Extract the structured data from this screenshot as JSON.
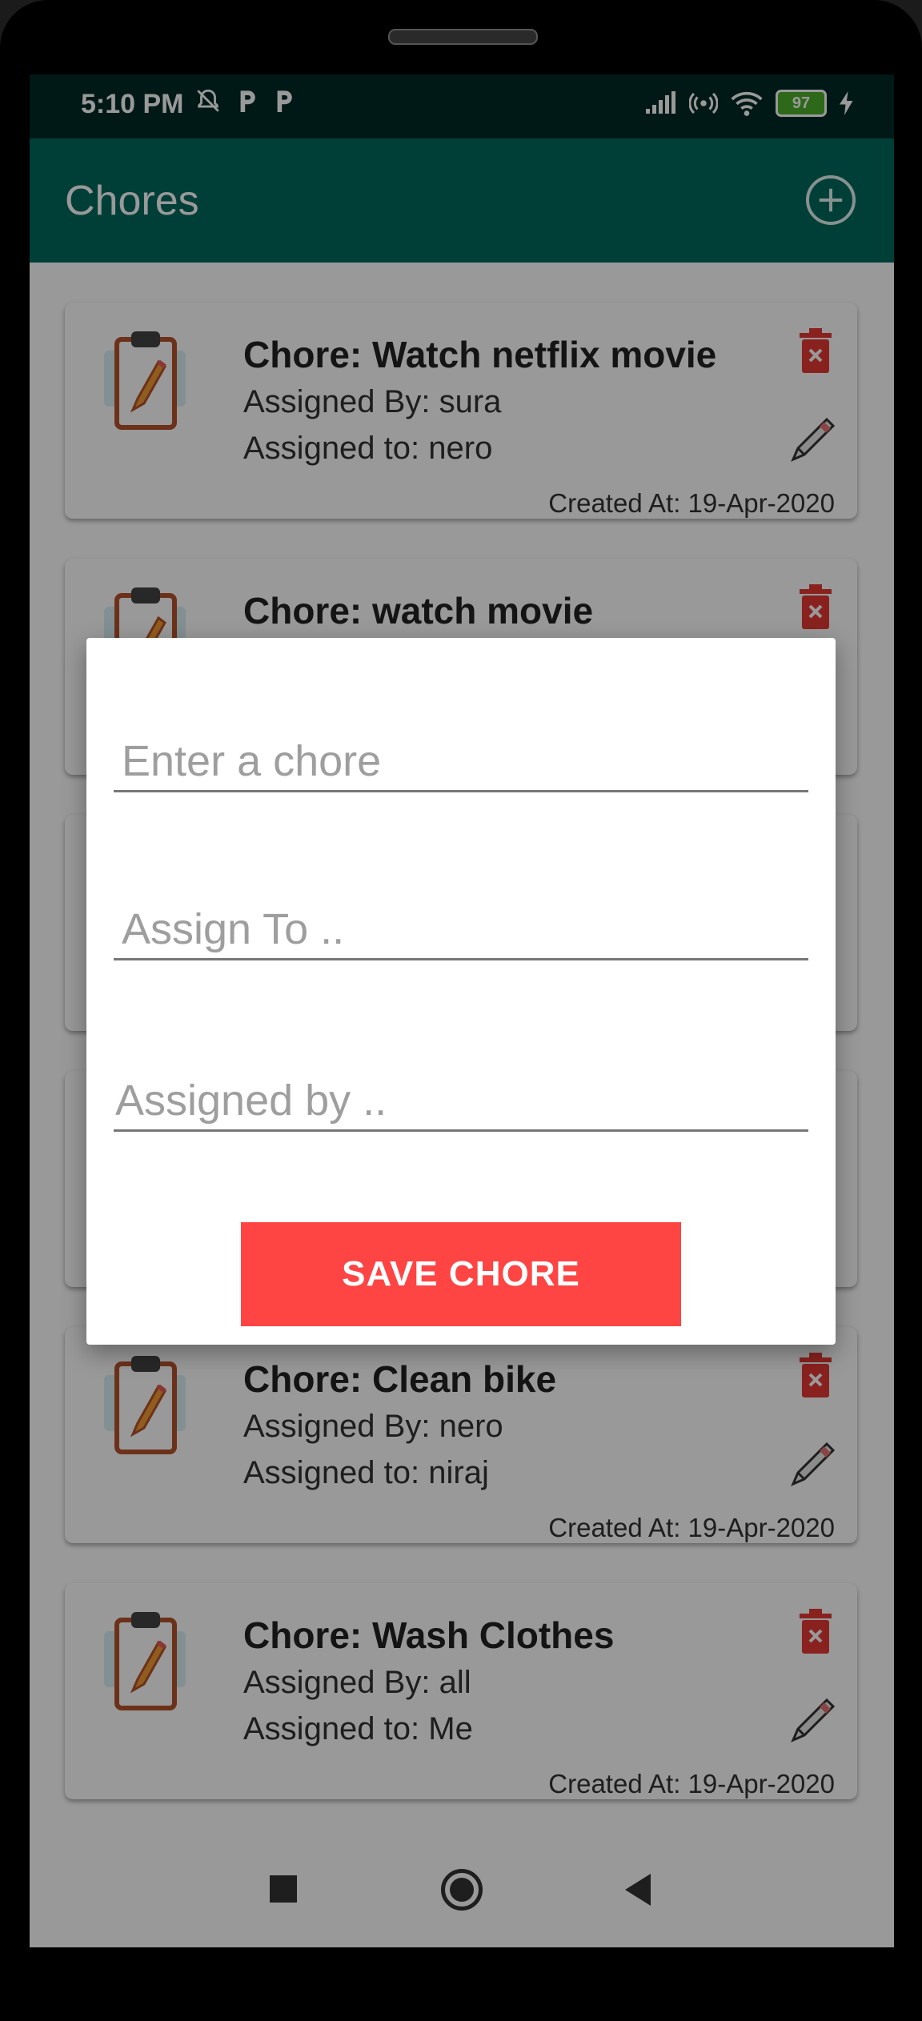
{
  "status_bar": {
    "time": "5:10 PM",
    "battery": "97",
    "icons_left": [
      "notifications-off-icon",
      "parking-icon",
      "parking-icon"
    ],
    "icons_right": [
      "signal-icon",
      "hotspot-icon",
      "wifi-icon",
      "battery-icon",
      "charging-icon"
    ]
  },
  "app_bar": {
    "title": "Chores",
    "add_icon": "add-circle-icon"
  },
  "chores": [
    {
      "title": "Chore: Watch netflix movie",
      "assigned_by": "Assigned By: sura",
      "assigned_to": "Assigned to: nero",
      "created": "Created At: 19-Apr-2020"
    },
    {
      "title": "Chore: watch movie",
      "assigned_by": "",
      "assigned_to": "",
      "created": ""
    },
    {
      "title": "",
      "assigned_by": "",
      "assigned_to": "",
      "created": ""
    },
    {
      "title": "",
      "assigned_by": "",
      "assigned_to": "",
      "created": ""
    },
    {
      "title": "Chore: Clean bike",
      "assigned_by": "Assigned By: nero",
      "assigned_to": "Assigned to: niraj",
      "created": "Created At: 19-Apr-2020"
    },
    {
      "title": "Chore: Wash Clothes",
      "assigned_by": "Assigned By: all",
      "assigned_to": "Assigned to: Me",
      "created": "Created At: 19-Apr-2020"
    }
  ],
  "dialog": {
    "chore_placeholder": "Enter a chore",
    "assign_to_placeholder": "Assign To ..",
    "assigned_by_placeholder": "Assigned by ..",
    "save_label": "SAVE CHORE"
  },
  "colors": {
    "status_bar": "#002b26",
    "app_bar": "#00695c",
    "delete_icon": "#e53935",
    "save_button": "#ff4444"
  }
}
